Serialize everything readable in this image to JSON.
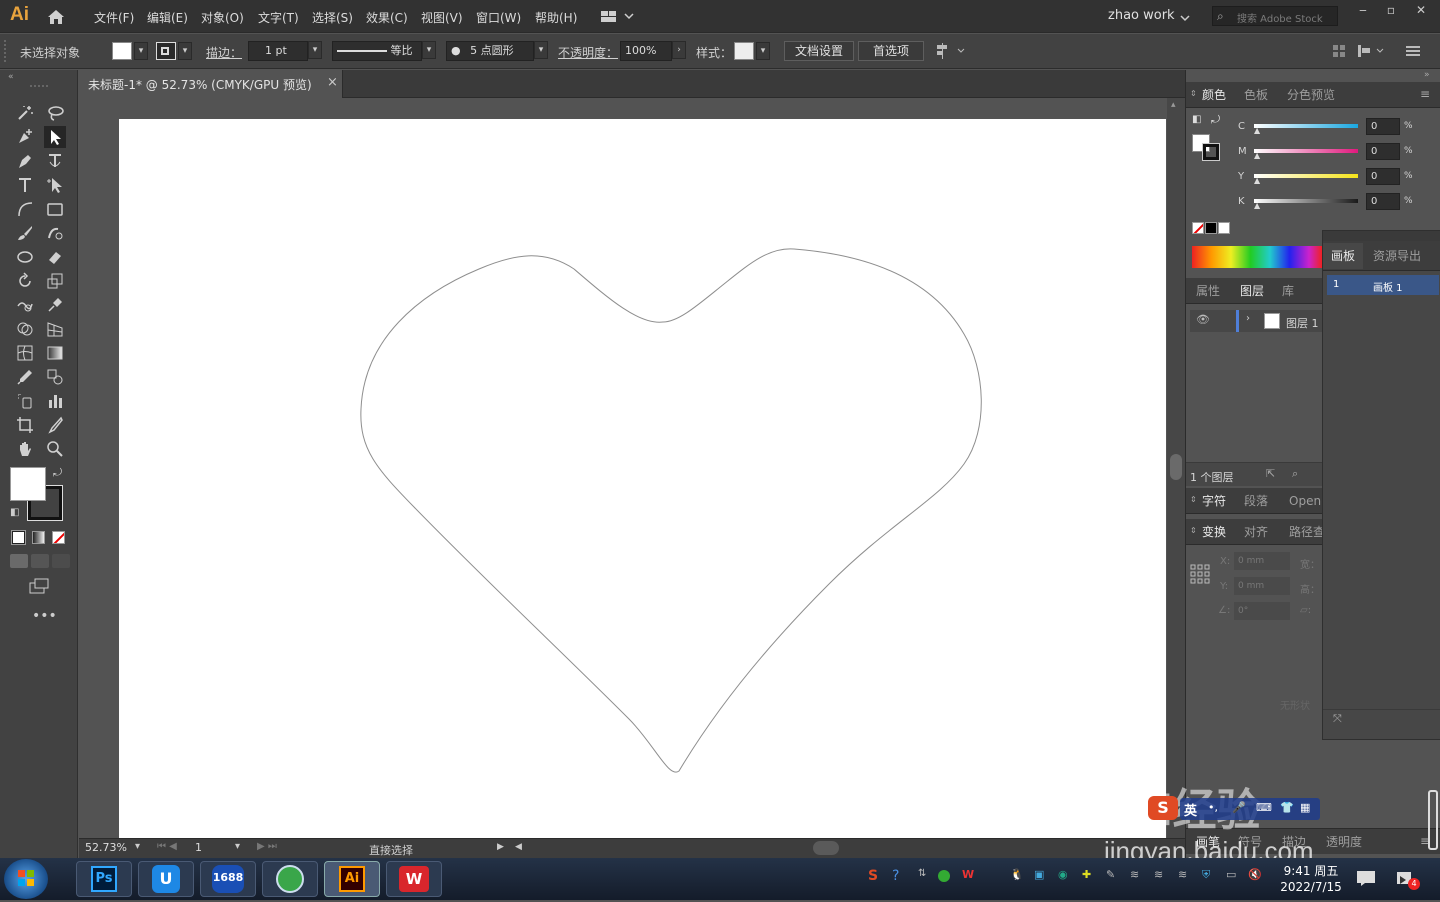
{
  "app": {
    "logo": "Ai"
  },
  "menu": [
    "文件(F)",
    "编辑(E)",
    "对象(O)",
    "文字(T)",
    "选择(S)",
    "效果(C)",
    "视图(V)",
    "窗口(W)",
    "帮助(H)"
  ],
  "workspace": "zhao work",
  "search": {
    "placeholder": "搜索 Adobe Stock"
  },
  "control": {
    "selection": "未选择对象",
    "stroke_label": "描边：",
    "stroke_value": "1 pt",
    "stroke_profile": "等比",
    "brush": "5 点圆形",
    "opacity_label": "不透明度：",
    "opacity_value": "100%",
    "style_label": "样式：",
    "doc_setup": "文档设置",
    "preferences": "首选项"
  },
  "document": {
    "tab_title": "未标题-1* @ 52.73% (CMYK/GPU 预览)",
    "close": "×"
  },
  "status": {
    "zoom": "52.73%",
    "artboard_num": "1",
    "tool": "直接选择"
  },
  "color_panel": {
    "tabs": [
      "颜色",
      "色板",
      "分色预览"
    ],
    "channels": [
      {
        "name": "C",
        "value": "0",
        "unit": "%"
      },
      {
        "name": "M",
        "value": "0",
        "unit": "%"
      },
      {
        "name": "Y",
        "value": "0",
        "unit": "%"
      },
      {
        "name": "K",
        "value": "0",
        "unit": "%"
      }
    ],
    "colors": {
      "c": "#1aa7e0",
      "m": "#e0197d",
      "y": "#f5e31a",
      "k": "#1a1a1a"
    }
  },
  "layers_panel": {
    "tabs": [
      "属性",
      "图层",
      "库"
    ],
    "layer_name": "图层 1",
    "count": "1 个图层"
  },
  "artboard_panel": {
    "tabs": [
      "画板",
      "资源导出"
    ],
    "row_num": "1",
    "row_name": "画板 1"
  },
  "char_panel": {
    "tabs": [
      "字符",
      "段落",
      "Open"
    ]
  },
  "transform_panel": {
    "tabs": [
      "变换",
      "对齐",
      "路径查"
    ],
    "x_label": "X:",
    "x_value": "0 mm",
    "w_label": "宽：",
    "y_label": "Y:",
    "y_value": "0 mm",
    "h_label": "高：",
    "angle_value": "0°",
    "no_shape": "无形状"
  },
  "bottom_tabs": [
    "画笔",
    "符号",
    "描边",
    "透明度"
  ],
  "watermark": {
    "text": "jingyan.baidu.com",
    "brand": "Bai经验"
  },
  "ime": {
    "mode": "英"
  },
  "taskbar": {
    "apps": [
      "Ps",
      "1688"
    ],
    "time": "9:41 周五",
    "date": "2022/7/15",
    "notify": "4"
  }
}
